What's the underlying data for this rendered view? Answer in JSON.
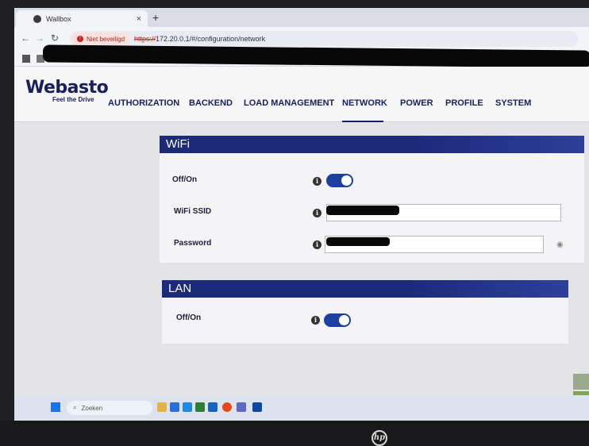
{
  "browser": {
    "tab_title": "Wallbox",
    "tab_close": "×",
    "new_tab": "+",
    "security_label": "Niet beveiligd",
    "url_protocol": "https://",
    "url_path": "172.20.0.1/#/configuration/network"
  },
  "app": {
    "logo_text": "Webasto",
    "logo_tagline": "Feel the Drive",
    "nav": [
      {
        "label": "AUTHORIZATION"
      },
      {
        "label": "BACKEND"
      },
      {
        "label": "LOAD MANAGEMENT"
      },
      {
        "label": "NETWORK",
        "active": true
      },
      {
        "label": "POWER"
      },
      {
        "label": "PROFILE"
      },
      {
        "label": "SYSTEM"
      }
    ],
    "accent_color": "#1c2a7a"
  },
  "wifi": {
    "title": "WiFi",
    "toggle_label": "Off/On",
    "toggle_state": "on",
    "ssid_label": "WiFi SSID",
    "ssid_value": "",
    "password_label": "Password",
    "password_value": ""
  },
  "lan": {
    "title": "LAN",
    "toggle_label": "Off/On",
    "toggle_state": "on"
  },
  "taskbar": {
    "search_placeholder": "Zoeken"
  },
  "device": {
    "brand_mark": "hp"
  },
  "icons": [
    "info-icon",
    "eye-icon",
    "reload-icon",
    "back-arrow-icon",
    "forward-arrow-icon",
    "windows-start-icon",
    "search-icon"
  ]
}
